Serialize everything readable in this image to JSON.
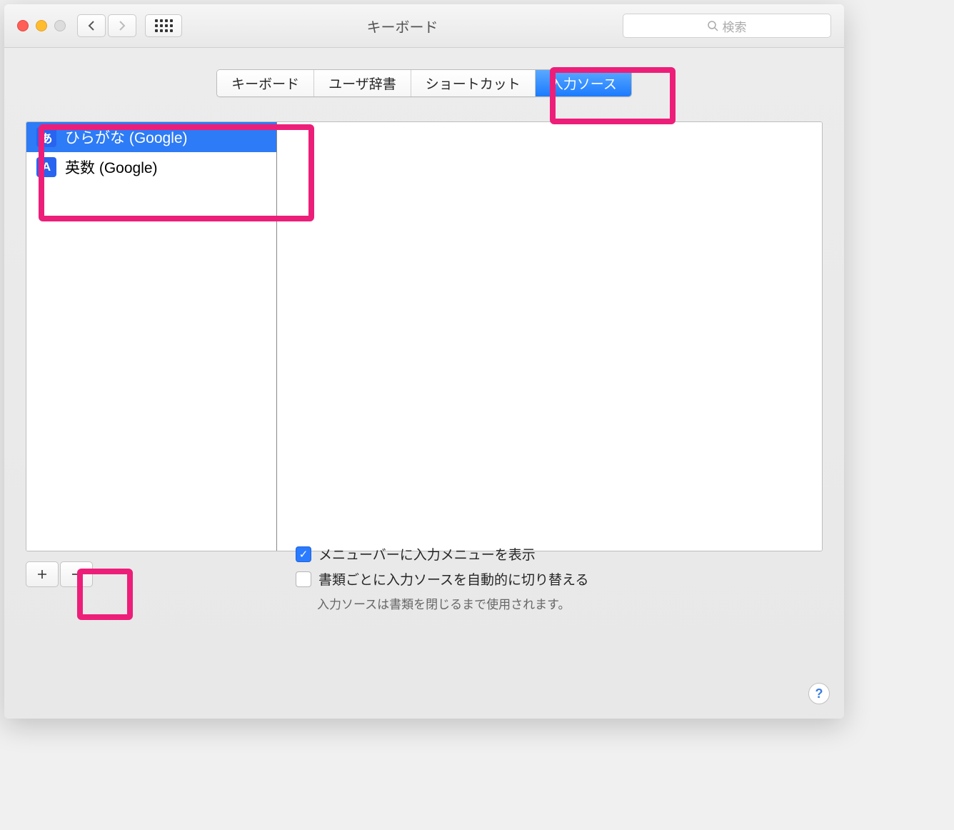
{
  "window": {
    "title": "キーボード"
  },
  "search": {
    "placeholder": "検索"
  },
  "tabs": [
    {
      "label": "キーボード",
      "active": false
    },
    {
      "label": "ユーザ辞書",
      "active": false
    },
    {
      "label": "ショートカット",
      "active": false
    },
    {
      "label": "入力ソース",
      "active": true
    }
  ],
  "sources": [
    {
      "icon_glyph": "あ",
      "label": "ひらがな (Google)",
      "selected": true
    },
    {
      "icon_glyph": "A",
      "label": "英数 (Google)",
      "selected": false
    }
  ],
  "options": {
    "show_menu": {
      "label": "メニューバーに入力メニューを表示",
      "checked": true
    },
    "per_doc": {
      "label": "書類ごとに入力ソースを自動的に切り替える",
      "checked": false
    },
    "note": "入力ソースは書類を閉じるまで使用されます。"
  }
}
